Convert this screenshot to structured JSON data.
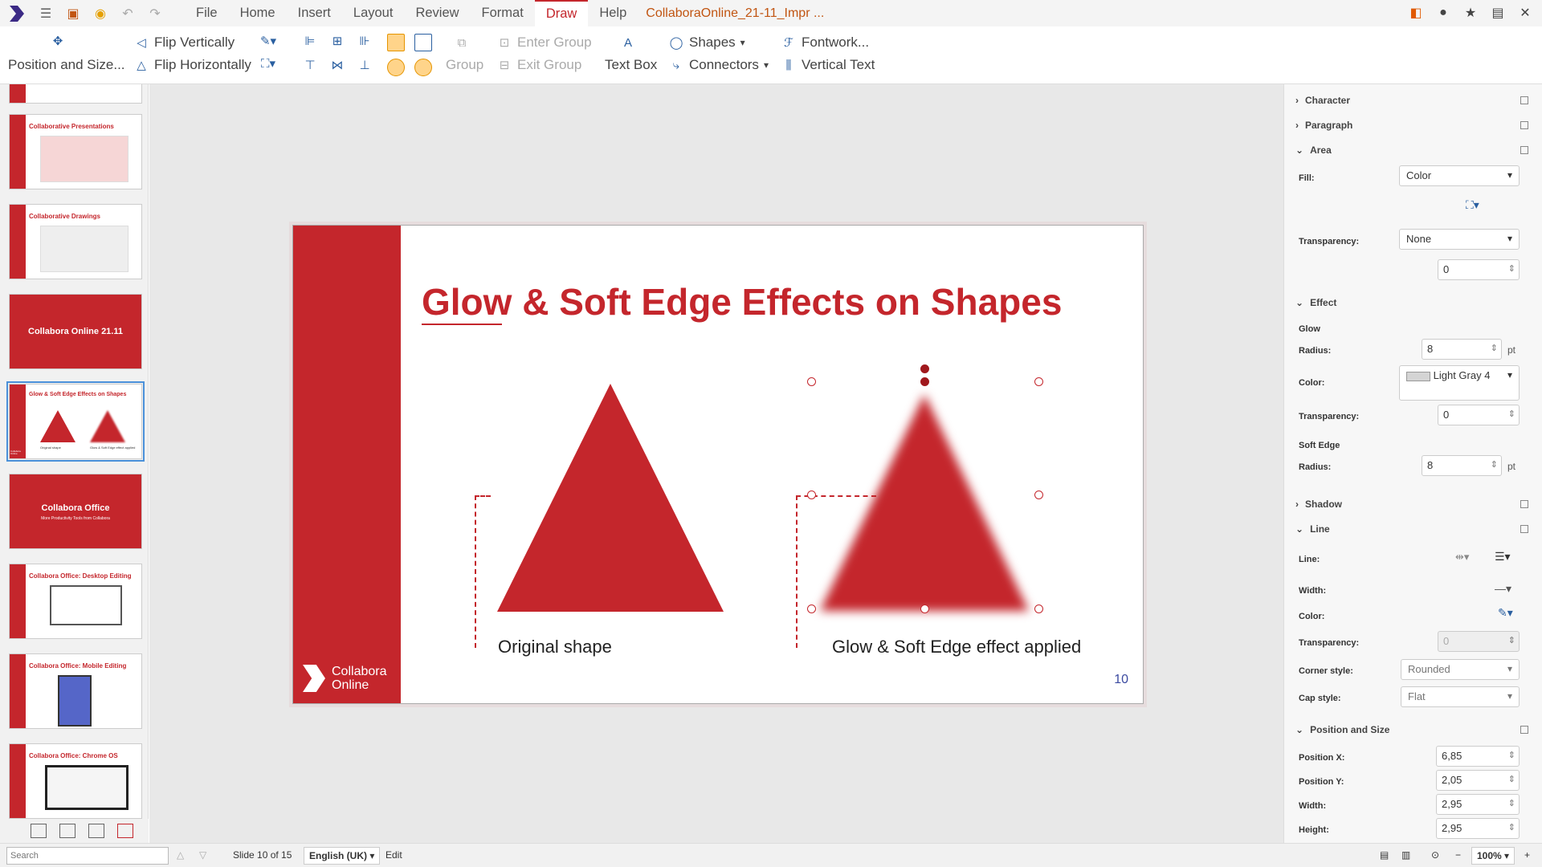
{
  "menubar": {
    "items": [
      "File",
      "Home",
      "Insert",
      "Layout",
      "Review",
      "Format",
      "Draw",
      "Help"
    ],
    "active": "Draw",
    "doc_title": "CollaboraOnline_21-11_Impr ..."
  },
  "toolbar": {
    "position_size": "Position and Size...",
    "flip_vertically": "Flip Vertically",
    "flip_horizontally": "Flip Horizontally",
    "group": "Group",
    "enter_group": "Enter Group",
    "exit_group": "Exit Group",
    "text_box": "Text Box",
    "shapes": "Shapes",
    "connectors": "Connectors",
    "fontwork": "Fontwork...",
    "vertical_text": "Vertical Text"
  },
  "slide_panel": {
    "thumbs": [
      {
        "title": "Collaborative Presentations"
      },
      {
        "title": "Collaborative Drawings"
      },
      {
        "title": "Collabora Online 21.11"
      },
      {
        "title": "Glow & Soft Edge Effects on Shapes"
      },
      {
        "title": "Collabora Office",
        "subtitle": "More Productivity Tools from Collabora"
      },
      {
        "title": "Collabora Office: Desktop Editing"
      },
      {
        "title": "Collabora Office: Mobile Editing"
      },
      {
        "title": "Collabora Office: Chrome OS"
      }
    ],
    "thumb_captions": {
      "left": "Original shape",
      "right": "Glow & Soft Edge effect applied"
    },
    "mini_brand": "Collabora Online"
  },
  "slide": {
    "title": "Glow & Soft Edge Effects on Shapes",
    "caption_left": "Original shape",
    "caption_right": "Glow & Soft Edge effect applied",
    "page_number": "10",
    "brand_line1": "Collabora",
    "brand_line2": "Online"
  },
  "sidebar": {
    "character": "Character",
    "paragraph": "Paragraph",
    "area": "Area",
    "fill_label": "Fill:",
    "fill_value": "Color",
    "transparency_label": "Transparency:",
    "transparency_value": "None",
    "transparency_num": "0",
    "effect": "Effect",
    "glow": "Glow",
    "radius_label": "Radius:",
    "glow_radius": "8",
    "pt": "pt",
    "color_label": "Color:",
    "glow_color": "Light Gray 4",
    "glow_transparency": "0",
    "soft_edge": "Soft Edge",
    "soft_radius": "8",
    "shadow": "Shadow",
    "line": "Line",
    "line_label": "Line:",
    "width_label": "Width:",
    "line_transparency": "0",
    "corner_label": "Corner style:",
    "corner_value": "Rounded",
    "cap_label": "Cap style:",
    "cap_value": "Flat",
    "pos_size": "Position and Size",
    "pos_x_label": "Position X:",
    "pos_x": "6,85",
    "pos_y_label": "Position Y:",
    "pos_y": "2,05",
    "w_label": "Width:",
    "w": "2,95",
    "h_label": "Height:",
    "h": "2,95"
  },
  "statusbar": {
    "search_placeholder": "Search",
    "slide_info": "Slide 10 of 15",
    "language": "English (UK)",
    "mode": "Edit",
    "zoom": "100%"
  },
  "colors": {
    "accent": "#c4262c",
    "brand_dark": "#3b2a85"
  }
}
